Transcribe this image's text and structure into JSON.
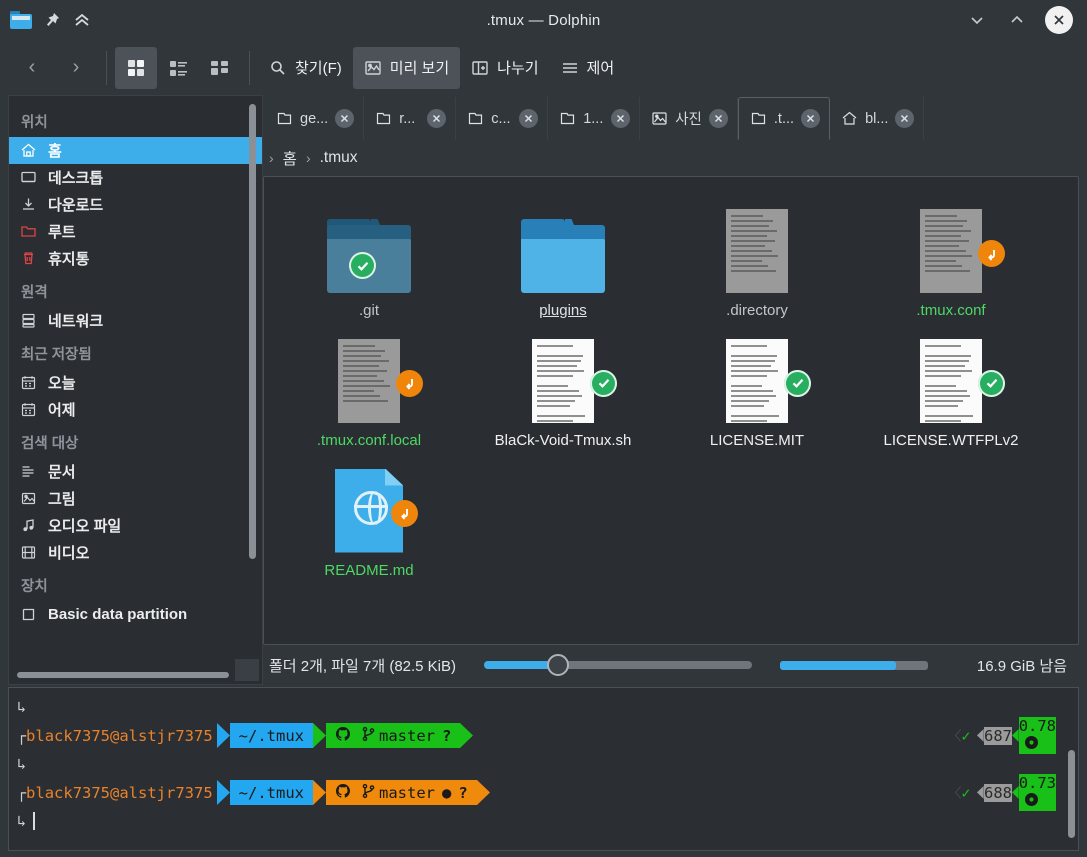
{
  "window": {
    "title": ".tmux — Dolphin",
    "app_icon": "folder-icon",
    "pin_icon": "pin-icon",
    "shade_icon": "chevron-double-up-icon",
    "minimize_icon": "chevron-down-icon",
    "maximize_icon": "chevron-up-icon",
    "close_icon": "close-icon"
  },
  "toolbar": {
    "back_label": "‹",
    "forward_label": "›",
    "view_icons_label": "icons-view",
    "view_details_label": "details-view",
    "view_columns_label": "columns-view",
    "find_label": "찾기(F)",
    "preview_label": "미리 보기",
    "split_label": "나누기",
    "control_label": "제어"
  },
  "sidebar": {
    "groups": [
      {
        "title": "위치",
        "items": [
          {
            "label": "홈",
            "icon": "home-icon",
            "selected": true
          },
          {
            "label": "데스크톱",
            "icon": "desktop-icon",
            "selected": false
          },
          {
            "label": "다운로드",
            "icon": "download-icon",
            "selected": false
          },
          {
            "label": "루트",
            "icon": "folder-red-icon",
            "selected": false
          },
          {
            "label": "휴지통",
            "icon": "trash-icon",
            "selected": false
          }
        ]
      },
      {
        "title": "원격",
        "items": [
          {
            "label": "네트워크",
            "icon": "network-icon",
            "selected": false
          }
        ]
      },
      {
        "title": "최근 저장됨",
        "items": [
          {
            "label": "오늘",
            "icon": "calendar-icon",
            "selected": false
          },
          {
            "label": "어제",
            "icon": "calendar-icon",
            "selected": false
          }
        ]
      },
      {
        "title": "검색 대상",
        "items": [
          {
            "label": "문서",
            "icon": "document-icon",
            "selected": false
          },
          {
            "label": "그림",
            "icon": "image-icon",
            "selected": false
          },
          {
            "label": "오디오 파일",
            "icon": "audio-icon",
            "selected": false
          },
          {
            "label": "비디오",
            "icon": "video-icon",
            "selected": false
          }
        ]
      },
      {
        "title": "장치",
        "items": [
          {
            "label": "Basic data partition",
            "icon": "drive-icon",
            "selected": false
          }
        ]
      }
    ]
  },
  "tabs": [
    {
      "label": "ge...",
      "icon": "folder-icon",
      "active": false
    },
    {
      "label": "r...",
      "icon": "folder-icon",
      "active": false
    },
    {
      "label": "c...",
      "icon": "folder-icon",
      "active": false
    },
    {
      "label": "1...",
      "icon": "folder-icon",
      "active": false
    },
    {
      "label": "사진",
      "icon": "image-icon",
      "active": false
    },
    {
      "label": ".t...",
      "icon": "folder-icon",
      "active": true
    },
    {
      "label": "bl...",
      "icon": "home-icon",
      "active": false
    }
  ],
  "breadcrumb": {
    "lead": "›",
    "items": [
      "홈",
      ".tmux"
    ],
    "separator": "›"
  },
  "files": [
    {
      "name": ".git",
      "type": "folder",
      "color": "dim",
      "badge": "check",
      "folder_shade": "dim"
    },
    {
      "name": "plugins",
      "type": "folder",
      "color": "hover",
      "badge": "none",
      "folder_shade": "bright"
    },
    {
      "name": ".directory",
      "type": "doc-gray",
      "color": "dim",
      "badge": "none"
    },
    {
      "name": ".tmux.conf",
      "type": "doc-gray",
      "color": "green",
      "badge": "link"
    },
    {
      "name": ".tmux.conf.local",
      "type": "doc-gray",
      "color": "green",
      "badge": "link"
    },
    {
      "name": "BlaCk-Void-Tmux.sh",
      "type": "doc-light",
      "color": "white",
      "badge": "check"
    },
    {
      "name": "LICENSE.MIT",
      "type": "doc-light",
      "color": "white",
      "badge": "check"
    },
    {
      "name": "LICENSE.WTFPLv2",
      "type": "doc-light",
      "color": "white",
      "badge": "check"
    },
    {
      "name": "README.md",
      "type": "html",
      "color": "green",
      "badge": "link"
    }
  ],
  "statusbar": {
    "summary": "폴더 2개, 파일 7개 (82.5 KiB)",
    "free_space": "16.9 GiB 남음"
  },
  "terminal": {
    "lines": [
      {
        "type": "continuation",
        "symbol": "↳"
      },
      {
        "type": "prompt",
        "symbol": "┌",
        "user": "black7375@alstjr7375",
        "path": "~/.tmux",
        "git_icon": "github-icon",
        "branch_icon": "branch-icon",
        "branch": "master",
        "dirty_dot": "",
        "question": "?",
        "git_color": "green",
        "status_icon": "✓",
        "cmd_number": "687",
        "duration": "0.78",
        "clock_icon": "clock-icon"
      },
      {
        "type": "continuation",
        "symbol": "↳"
      },
      {
        "type": "prompt",
        "symbol": "┌",
        "user": "black7375@alstjr7375",
        "path": "~/.tmux",
        "git_icon": "github-icon",
        "branch_icon": "branch-icon",
        "branch": "master",
        "dirty_dot": "●",
        "question": "?",
        "git_color": "orange",
        "status_icon": "✓",
        "cmd_number": "688",
        "duration": "0.73",
        "clock_icon": "clock-icon"
      },
      {
        "type": "cursor",
        "symbol": "↳"
      }
    ]
  },
  "colors": {
    "accent": "#3daee9",
    "window_bg": "#31363b",
    "panel_bg": "#2a2e32",
    "green": "#18c018",
    "orange": "#f08a0c",
    "file_green": "#4cd964"
  }
}
